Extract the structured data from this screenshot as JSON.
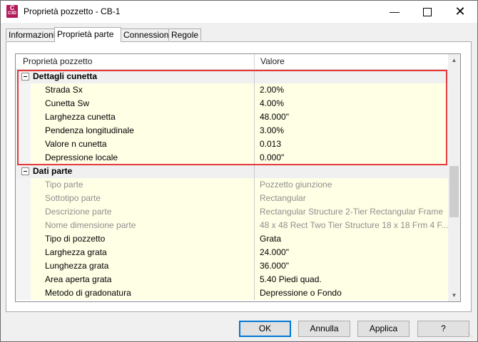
{
  "window": {
    "title": "Proprietà pozzetto - CB-1",
    "app_icon_text_top": "C",
    "app_icon_text_bottom": "C3D",
    "min_icon": "minimize-icon",
    "max_icon": "maximize-icon",
    "close_icon": "close-icon"
  },
  "tabs": [
    {
      "label": "Informazioni",
      "active": false
    },
    {
      "label": "Proprietà parte",
      "active": true
    },
    {
      "label": "Connessioni",
      "active": false
    },
    {
      "label": "Regole",
      "active": false
    }
  ],
  "grid": {
    "columns": [
      "Proprietà pozzetto",
      "Valore"
    ],
    "categories": [
      {
        "label": "Dettagli cunetta",
        "rows": [
          {
            "name": "Strada Sx",
            "value": "2.00%",
            "readonly": false
          },
          {
            "name": "Cunetta Sw",
            "value": "4.00%",
            "readonly": false
          },
          {
            "name": "Larghezza cunetta",
            "value": "48.000\"",
            "readonly": false
          },
          {
            "name": "Pendenza longitudinale",
            "value": "3.00%",
            "readonly": false
          },
          {
            "name": "Valore n cunetta",
            "value": "0.013",
            "readonly": false
          },
          {
            "name": "Depressione locale",
            "value": "0.000\"",
            "readonly": false
          }
        ]
      },
      {
        "label": "Dati parte",
        "rows": [
          {
            "name": "Tipo parte",
            "value": "Pozzetto giunzione",
            "readonly": true
          },
          {
            "name": "Sottotipo parte",
            "value": "Rectangular",
            "readonly": true
          },
          {
            "name": "Descrizione parte",
            "value": "Rectangular Structure 2-Tier Rectangular Frame",
            "readonly": true
          },
          {
            "name": "Nome dimensione parte",
            "value": "48 x 48 Rect Two Tier Structure 18 x 18 Frm 4 F...",
            "readonly": true
          },
          {
            "name": "Tipo di pozzetto",
            "value": "Grata",
            "readonly": false
          },
          {
            "name": "Larghezza grata",
            "value": "24.000\"",
            "readonly": false
          },
          {
            "name": "Lunghezza grata",
            "value": "36.000\"",
            "readonly": false
          },
          {
            "name": "Area aperta grata",
            "value": "5.40 Piedi quad.",
            "readonly": false
          },
          {
            "name": "Metodo di gradonatura",
            "value": "Depressione o Fondo",
            "readonly": false
          }
        ]
      }
    ]
  },
  "buttons": {
    "ok": "OK",
    "cancel": "Annulla",
    "apply": "Applica",
    "help": "?"
  },
  "colors": {
    "highlight": "#e5393c",
    "row_bg": "#ffffe6",
    "readonly_text": "#8e8e8e"
  }
}
